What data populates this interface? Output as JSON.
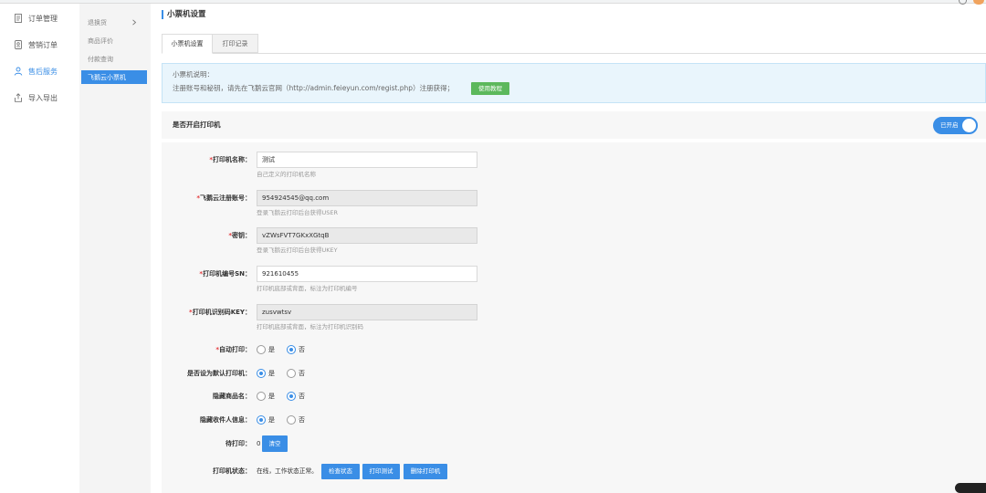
{
  "colors": {
    "accent": "#3a8ee6",
    "success": "#5cb85c",
    "required": "#e4393c"
  },
  "sidebar": {
    "items": [
      {
        "label": "订单管理",
        "icon": "order-list-icon",
        "active": false
      },
      {
        "label": "营销订单",
        "icon": "marketing-order-icon",
        "active": false
      },
      {
        "label": "售后服务",
        "icon": "after-sales-user-icon",
        "active": true
      },
      {
        "label": "导入导出",
        "icon": "import-export-icon",
        "active": false
      }
    ]
  },
  "subnav": {
    "arrow_icon": "chevron-right-icon",
    "items": [
      {
        "label": "退换货",
        "active": false
      },
      {
        "label": "商品评价",
        "active": false
      },
      {
        "label": "付款查询",
        "active": false
      },
      {
        "label": "飞鹅云小票机",
        "active": true
      }
    ]
  },
  "page": {
    "title": "小票机设置"
  },
  "tabs": [
    {
      "label": "小票机设置",
      "active": true
    },
    {
      "label": "打印记录",
      "active": false
    }
  ],
  "notice": {
    "title": "小票机说明：",
    "text": "注册账号和秘钥，请先在飞鹅云官网（http://admin.feieyun.com/regist.php）注册获得；",
    "button": "使用教程"
  },
  "printer_switch": {
    "label": "是否开启打印机",
    "state_label": "已开启",
    "on": true
  },
  "form": {
    "required_mark": "*",
    "fields": [
      {
        "label": "打印机名称：",
        "required": true,
        "value": "测试",
        "readonly": false,
        "hint": "自己定义的打印机名称"
      },
      {
        "label": "飞鹅云注册账号：",
        "required": true,
        "value": "954924545@qq.com",
        "readonly": true,
        "hint": "登录飞鹅云打印后台获得USER"
      },
      {
        "label": "密钥：",
        "required": true,
        "value": "vZWsFVT7GKxXGtqB",
        "readonly": true,
        "hint": "登录飞鹅云打印后台获得UKEY"
      },
      {
        "label": "打印机编号SN：",
        "required": true,
        "value": "921610455",
        "readonly": false,
        "hint": "打印机底部或背面，标注为打印机编号"
      },
      {
        "label": "打印机识别码KEY：",
        "required": true,
        "value": "zusvwtsv",
        "readonly": true,
        "hint": "打印机底部或背面，标注为打印机识别码"
      }
    ],
    "options": [
      {
        "label": "自动打印：",
        "required": true,
        "choices": [
          {
            "label": "是",
            "checked": false
          },
          {
            "label": "否",
            "checked": true
          }
        ]
      },
      {
        "label": "是否设为默认打印机：",
        "required": false,
        "choices": [
          {
            "label": "是",
            "checked": true
          },
          {
            "label": "否",
            "checked": false
          }
        ]
      },
      {
        "label": "隐藏商品名：",
        "required": false,
        "choices": [
          {
            "label": "是",
            "checked": false
          },
          {
            "label": "否",
            "checked": true
          }
        ]
      },
      {
        "label": "隐藏收件人信息：",
        "required": false,
        "choices": [
          {
            "label": "是",
            "checked": true
          },
          {
            "label": "否",
            "checked": false
          }
        ]
      }
    ],
    "pending": {
      "label": "待打印：",
      "count": "0",
      "clear_button": "清空"
    },
    "status": {
      "label": "打印机状态：",
      "text": "在线，工作状态正常。",
      "buttons": [
        "检查状态",
        "打印测试",
        "删除打印机"
      ]
    }
  }
}
